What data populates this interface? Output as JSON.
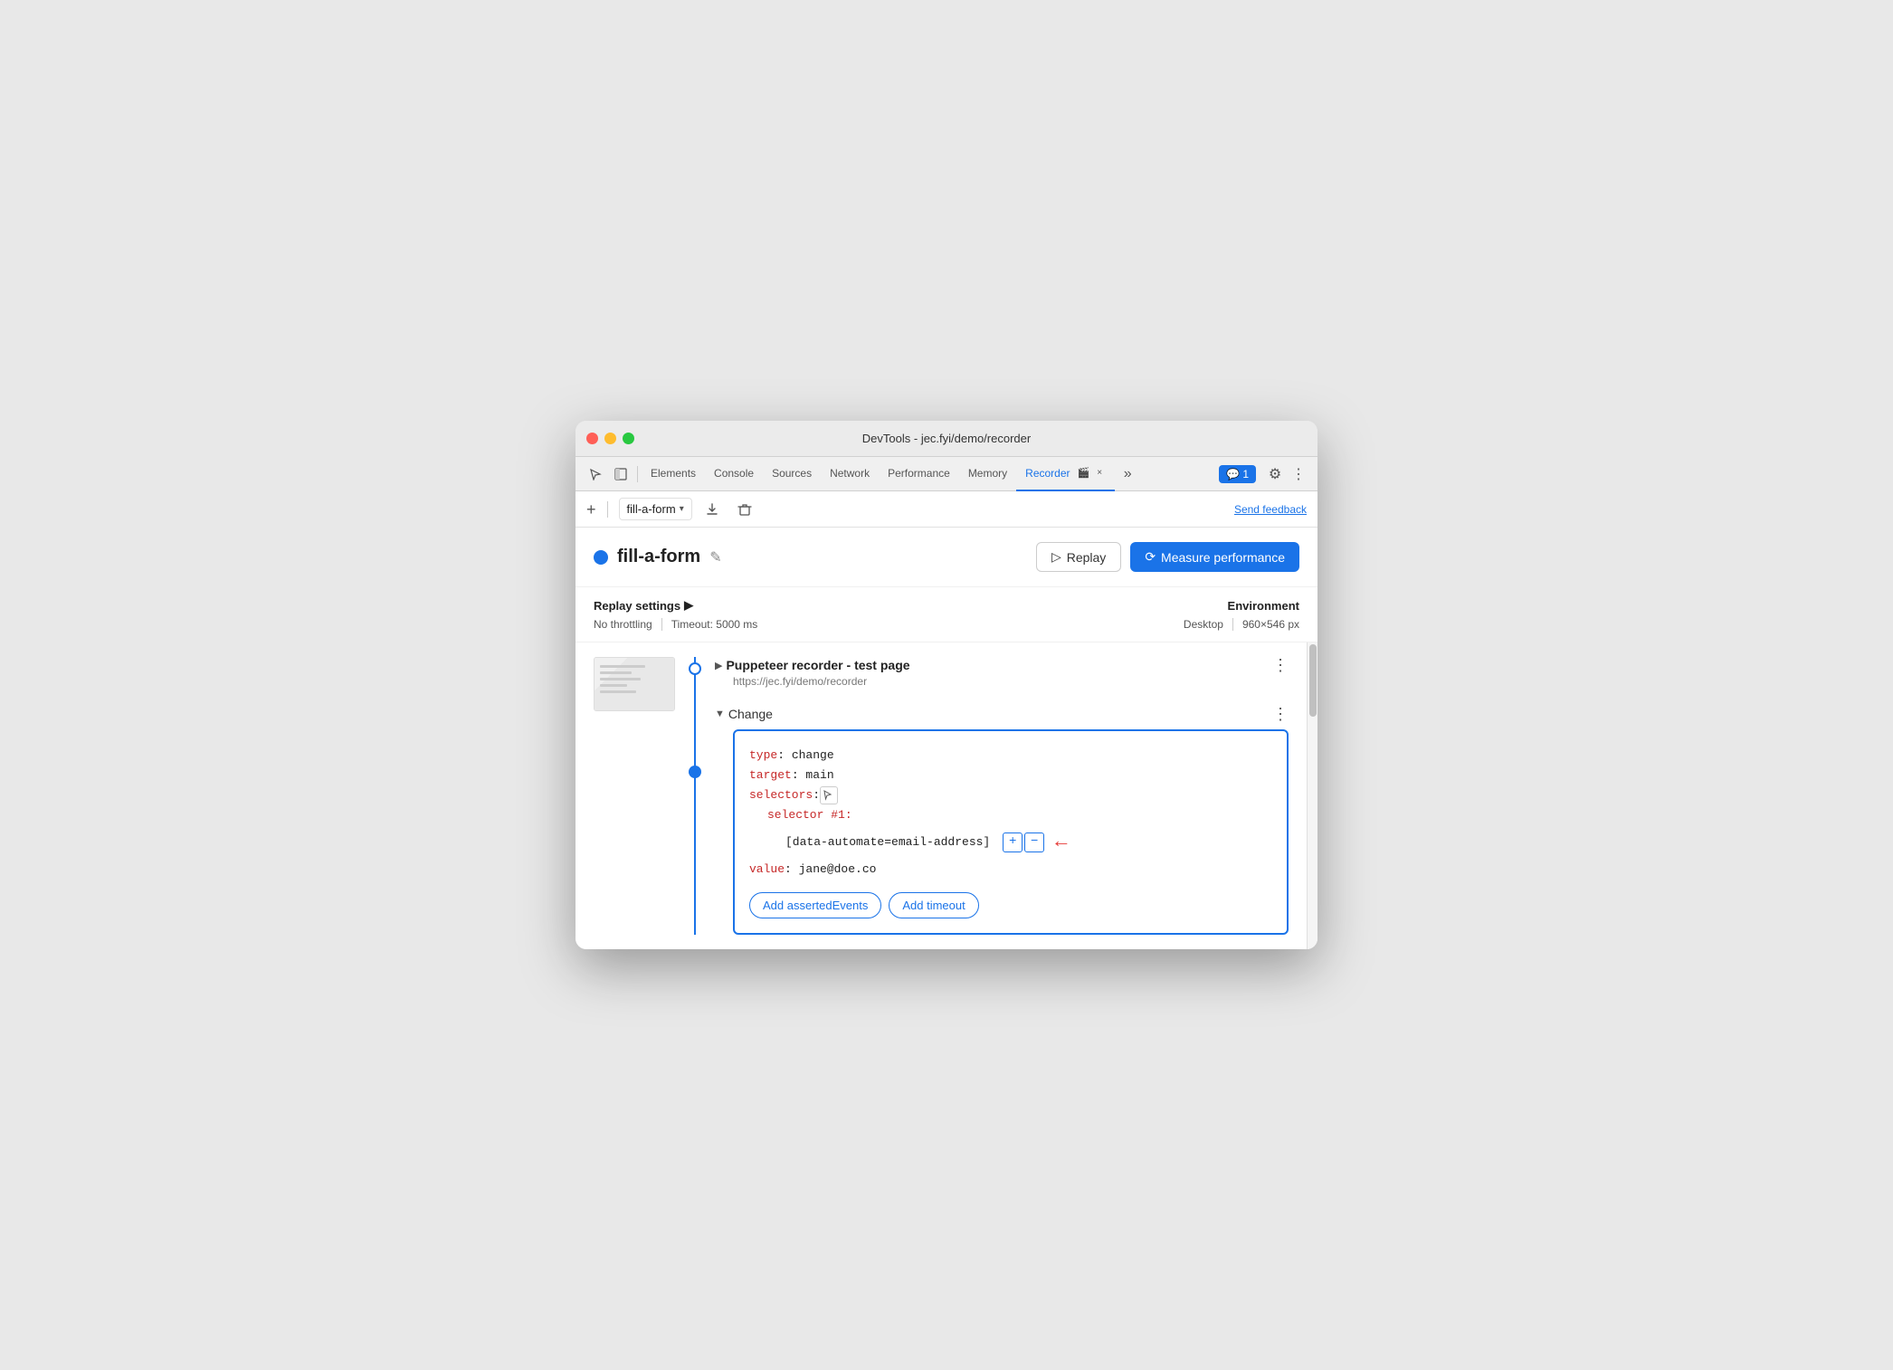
{
  "window": {
    "title": "DevTools - jec.fyi/demo/recorder"
  },
  "tabs": {
    "items": [
      {
        "label": "Elements",
        "active": false
      },
      {
        "label": "Console",
        "active": false
      },
      {
        "label": "Sources",
        "active": false
      },
      {
        "label": "Network",
        "active": false
      },
      {
        "label": "Performance",
        "active": false
      },
      {
        "label": "Memory",
        "active": false
      },
      {
        "label": "Recorder",
        "active": true
      }
    ],
    "recorder_close": "×",
    "more": "»",
    "chat_count": "1",
    "gear": "⚙",
    "dots": "⋮"
  },
  "toolbar": {
    "add_label": "+",
    "recording_name": "fill-a-form",
    "chevron": "▾",
    "download_title": "download",
    "delete_title": "delete",
    "send_feedback": "Send feedback"
  },
  "header": {
    "dot_color": "#1a73e8",
    "recording_name": "fill-a-form",
    "edit_icon": "✎",
    "replay_label": "Replay",
    "replay_icon": "▷",
    "measure_label": "Measure performance",
    "measure_icon": "⟳"
  },
  "settings": {
    "replay_settings_label": "Replay settings",
    "expand_icon": "▶",
    "throttling": "No throttling",
    "timeout": "Timeout: 5000 ms",
    "environment_label": "Environment",
    "desktop": "Desktop",
    "resolution": "960×546 px"
  },
  "steps": {
    "step1": {
      "title": "Puppeteer recorder - test page",
      "url": "https://jec.fyi/demo/recorder",
      "dots": "⋮",
      "expand_icon": "▶"
    },
    "step2": {
      "title": "Change",
      "expand_icon": "▼",
      "dots": "⋮",
      "code": {
        "type_key": "type",
        "type_val": ": change",
        "target_key": "target",
        "target_val": ": main",
        "selectors_key": "selectors",
        "selector_num_label": "selector #1:",
        "selector_value": "[data-automate=email-address]",
        "value_key": "value",
        "value_val": ": jane@doe.co"
      },
      "btn_assert": "Add assertedEvents",
      "btn_timeout": "Add timeout"
    }
  },
  "icons": {
    "cursor_icon": "↖",
    "duplicate_icon": "⧉",
    "plus_icon": "+",
    "minus_icon": "−",
    "arrow_right": "←"
  }
}
